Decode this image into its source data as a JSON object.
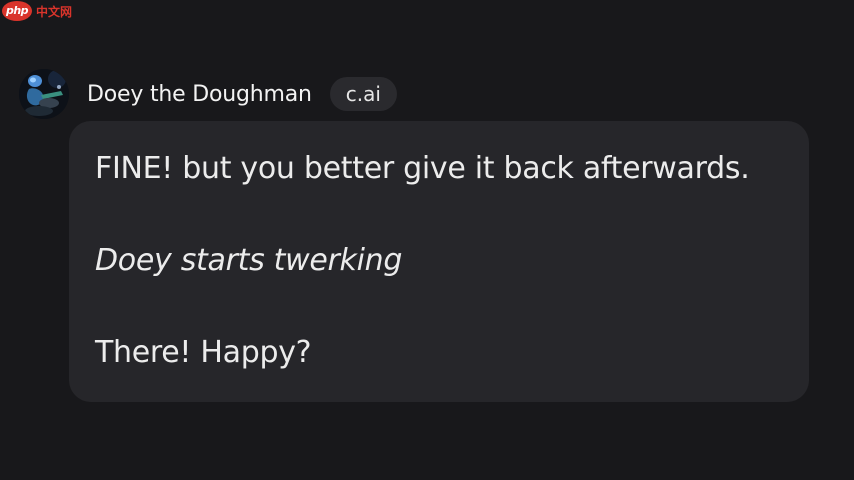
{
  "watermark": {
    "logo_text": "php",
    "site_text": "中文网"
  },
  "message": {
    "character_name": "Doey the Doughman",
    "badge": "c.ai",
    "lines": [
      "FINE! but you better give it back afterwards.",
      "Doey starts twerking",
      "There! Happy?"
    ]
  },
  "colors": {
    "background": "#18181b",
    "bubble": "#26262a",
    "badge_bg": "#2a2a2e",
    "text": "#ececec",
    "watermark": "#d9342b"
  },
  "icons": {
    "avatar": "character-avatar"
  }
}
